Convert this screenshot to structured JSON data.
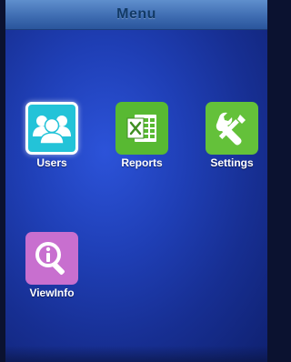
{
  "header": {
    "title": "Menu"
  },
  "menu": {
    "items": [
      {
        "label": "Users",
        "icon": "users-group-icon",
        "color": "#23c3d8",
        "selected": true
      },
      {
        "label": "Reports",
        "icon": "excel-sheet-icon",
        "color": "#58b932",
        "selected": false
      },
      {
        "label": "Settings",
        "icon": "wrench-screwdriver-icon",
        "color": "#64c13a",
        "selected": false
      },
      {
        "label": "ViewInfo",
        "icon": "info-magnifier-icon",
        "color": "#c86fcf",
        "selected": false
      }
    ]
  },
  "colors": {
    "background": "#1f3fb6",
    "titlebar": "#3f6db2",
    "title_text": "#123a66",
    "label_text": "#ffffff"
  }
}
